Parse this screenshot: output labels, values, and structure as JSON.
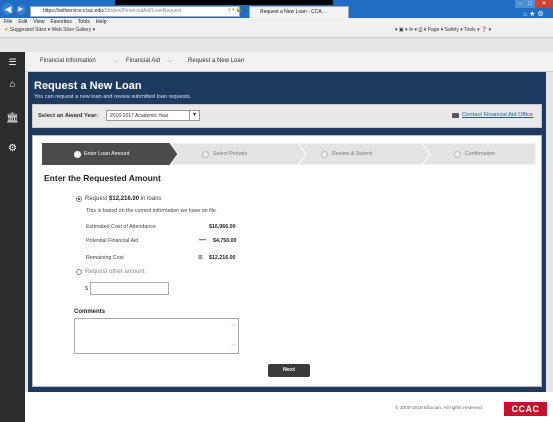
{
  "browser": {
    "url_host": "https://selfservice.ccac.edu",
    "url_path": "/Student/FinancialAid/LoanRequest",
    "addr_icons": "⌕ ▾ 🔒 C",
    "tab_title": "Request a New Loan - CCA...",
    "menu": [
      "File",
      "Edit",
      "View",
      "Favorites",
      "Tools",
      "Help"
    ],
    "fav_items": [
      "Suggested Sites ▾",
      "Web Slice Gallery ▾"
    ],
    "cmd_items": "▾ ▣ ▾ ✉ ▾ ⎙ ▾ Page ▾ Safety ▾ Tools ▾ ❓ ▾"
  },
  "breadcrumb": [
    "Financial Information",
    "Financial Aid",
    "Request a New Loan"
  ],
  "page": {
    "title": "Request a New Loan",
    "subtitle": "You can request a new loan and review submitted loan requests."
  },
  "award": {
    "label": "Select an Award Year:",
    "selected": "2016-2017 Academic Year",
    "contact_link": "Contact Financial Aid Office"
  },
  "steps": [
    "Enter Loan Amount",
    "Select Periods",
    "Review & Submit",
    "Confirmation"
  ],
  "form": {
    "section_title": "Enter the Requested Amount",
    "request_prefix": "Request",
    "request_amount": "$12,216.00",
    "request_suffix": "in loans",
    "basis_note": "This is based on the current information we have on file.",
    "rows": [
      {
        "label": "Estimated Cost of Attendance",
        "op": "",
        "value": "$16,966.00"
      },
      {
        "label": "Potential Financial Aid",
        "op": "—",
        "value": "$4,750.00"
      },
      {
        "label": "Remaining Cost",
        "op": "=",
        "value": "$12,216.00"
      }
    ],
    "other_label": "Request other amount:",
    "currency": "$",
    "comments_label": "Comments",
    "next_button": "Next"
  },
  "footer": {
    "copyright": "© 2000-2016 Ellucian. All rights reserved.",
    "logo_text": "CCAC"
  }
}
